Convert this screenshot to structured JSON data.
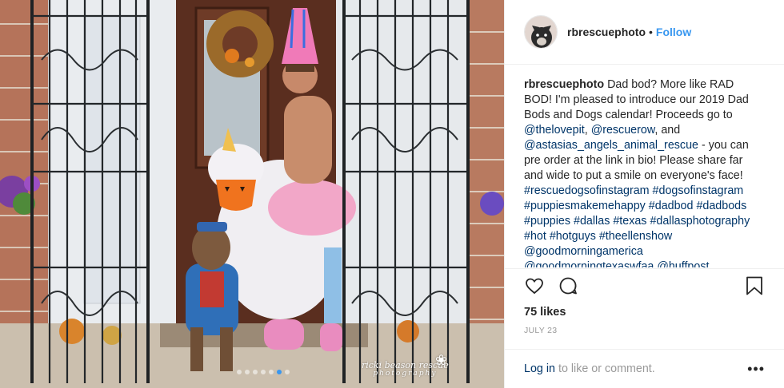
{
  "header": {
    "username": "rbrescuephoto",
    "separator": "•",
    "follow_label": "Follow"
  },
  "caption": {
    "username": "rbrescuephoto",
    "text_1": "Dad bod? More like RAD BOD! I'm pleased to introduce our 2019 Dad Bods and Dogs calendar! Proceeds go to",
    "mention_1": "@thelovepit",
    "text_2": ",",
    "mention_2": "@rescuerow",
    "text_3": ", and",
    "mention_3": "@astasias_angels_animal_rescue",
    "text_4": "- you can pre order at the link in bio! Please share far and wide to put a smile on everyone's face!",
    "tags": [
      "#rescuedogsofinstagram",
      "#dogsofinstagram",
      "#puppiesmakemehappy",
      "#dadbod",
      "#dadbods",
      "#puppies",
      "#dallas",
      "#texas",
      "#dallasphotography",
      "#hot",
      "#hotguys",
      "#theellenshow",
      "@goodmorningamerica",
      "@goodmorningtexaswfaa",
      "@huffpost"
    ]
  },
  "actions": {
    "like_icon": "heart-icon",
    "comment_icon": "comment-icon",
    "save_icon": "bookmark-icon"
  },
  "likes": "75 likes",
  "date": "JULY 23",
  "footer": {
    "login_label": "Log in",
    "rest_label": "to like or comment.",
    "more_label": "•••"
  },
  "photo": {
    "watermark_line1": "ricki beason rescue",
    "watermark_line2": "photography",
    "carousel": {
      "count": 7,
      "active_index": 5
    }
  },
  "colors": {
    "link": "#003569",
    "follow": "#3897f0",
    "muted": "#999999",
    "text": "#262626"
  }
}
